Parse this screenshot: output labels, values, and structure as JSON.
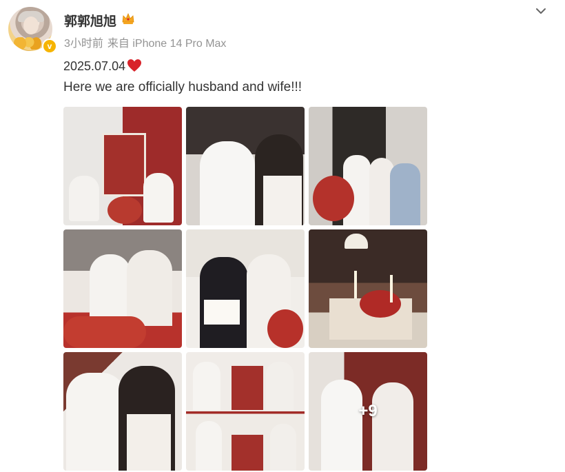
{
  "post": {
    "username": "郭郭旭旭",
    "time_ago": "3小时前",
    "source": "来自 iPhone 14 Pro Max",
    "date_text": "2025.07.04",
    "caption": "Here we are officially husband and wife!!!",
    "verified_badge": "v",
    "more_photos_label": "+9"
  },
  "icons": {
    "crown": "crown-icon",
    "heart": "red-heart-emoji",
    "chevron": "chevron-down-icon",
    "verified": "verified-badge-icon"
  },
  "colors": {
    "verified": "#f6b400",
    "heart": "#d8232a",
    "meta_text": "#939393",
    "text": "#333333"
  },
  "photos": [
    {
      "label": "couple seated beside red welcome sign"
    },
    {
      "label": "couple close-up laughing with wine glass"
    },
    {
      "label": "couple with friends by doorway"
    },
    {
      "label": "couple seated with wine glasses"
    },
    {
      "label": "couple holding marriage certificate"
    },
    {
      "label": "candlelit banquet table"
    },
    {
      "label": "couple embracing"
    },
    {
      "label": "couple standing by welcome sign"
    },
    {
      "label": "couple standing in white"
    }
  ]
}
